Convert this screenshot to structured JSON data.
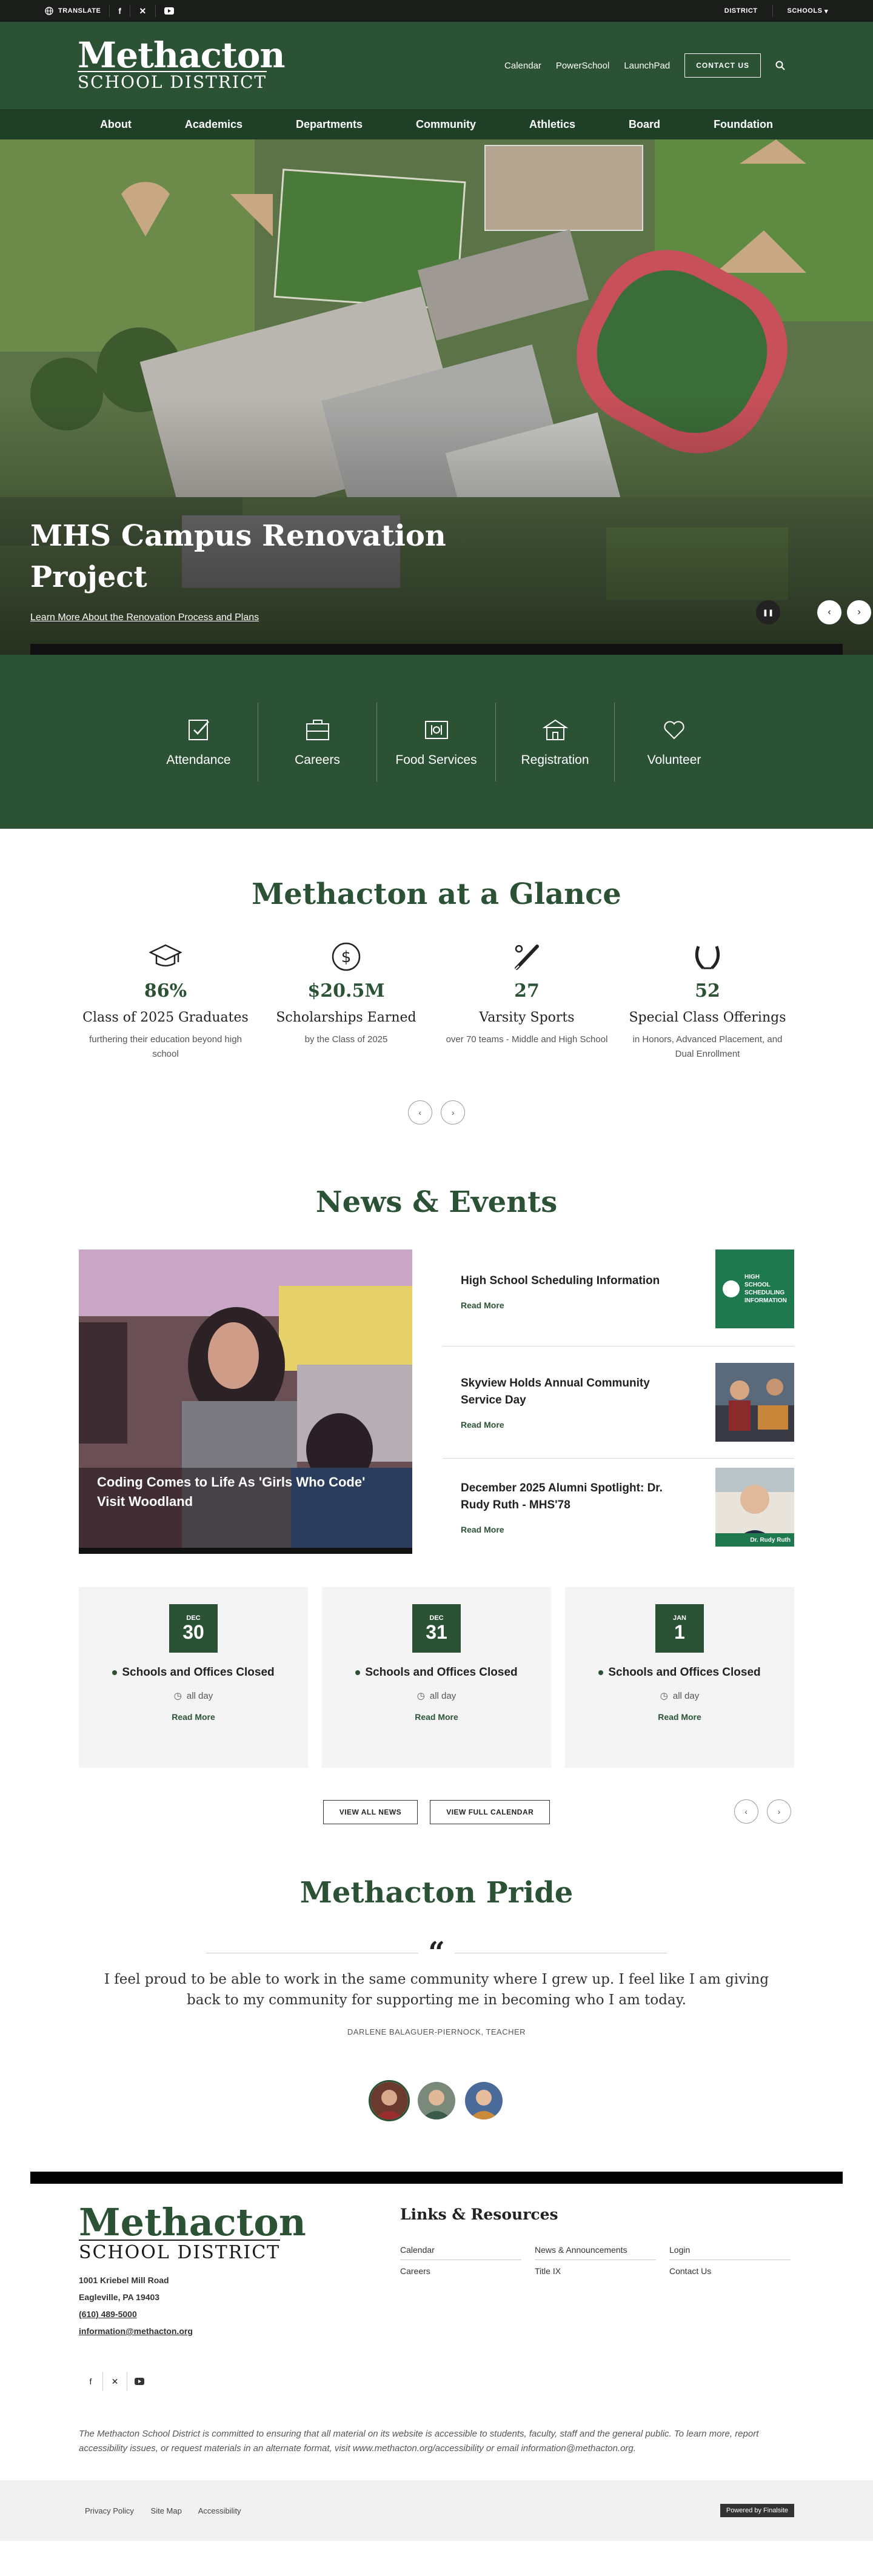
{
  "utility": {
    "translate": "TRANSLATE",
    "district": "DISTRICT",
    "schools": "SCHOOLS"
  },
  "brand": {
    "logo_top": "Methacton",
    "logo_bottom": "SCHOOL DISTRICT",
    "primary_color": "#2b5234",
    "dark_color": "#1f3f27"
  },
  "header": {
    "links": [
      "Calendar",
      "PowerSchool",
      "LaunchPad"
    ],
    "contact": "CONTACT US"
  },
  "nav": [
    "About",
    "Academics",
    "Departments",
    "Community",
    "Athletics",
    "Board",
    "Foundation"
  ],
  "hero": {
    "title": "MHS Campus Renovation Project",
    "link": "Learn More About the Renovation Process and Plans"
  },
  "quick_links": [
    {
      "label": "Attendance",
      "icon": "clipboard-check-icon"
    },
    {
      "label": "Careers",
      "icon": "briefcase-icon"
    },
    {
      "label": "Food Services",
      "icon": "menu-icon"
    },
    {
      "label": "Registration",
      "icon": "school-building-icon"
    },
    {
      "label": "Volunteer",
      "icon": "heart-hand-icon"
    }
  ],
  "glance": {
    "title": "Methacton at a Glance",
    "stats": [
      {
        "icon": "graduation-cap-icon",
        "value": "86%",
        "title": "Class of 2025 Graduates",
        "desc": "furthering their education beyond high school"
      },
      {
        "icon": "dollar-icon",
        "value": "$20.5M",
        "title": "Scholarships Earned",
        "desc": "by the Class of 2025"
      },
      {
        "icon": "baseball-bat-icon",
        "value": "27",
        "title": "Varsity Sports",
        "desc": "over 70 teams - Middle and High School"
      },
      {
        "icon": "laurel-wreath-icon",
        "value": "52",
        "title": "Special Class Offerings",
        "desc": "in Honors, Advanced Placement, and Dual Enrollment"
      }
    ]
  },
  "news": {
    "title": "News & Events",
    "feature": "Coding Comes to Life As 'Girls Who Code' Visit Woodland",
    "items": [
      {
        "title": "High School Scheduling Information",
        "read_more": "Read More",
        "thumb_text": "HIGH SCHOOL SCHEDULING INFORMATION"
      },
      {
        "title": "Skyview Holds Annual Community Service Day",
        "read_more": "Read More"
      },
      {
        "title": "December 2025 Alumni Spotlight: Dr. Rudy Ruth - MHS'78",
        "read_more": "Read More",
        "thumb_text": "Dr. Rudy Ruth"
      }
    ],
    "events": [
      {
        "month": "DEC",
        "day": "30",
        "title": "Schools and Offices Closed",
        "time": "all day",
        "read_more": "Read More"
      },
      {
        "month": "DEC",
        "day": "31",
        "title": "Schools and Offices Closed",
        "time": "all day",
        "read_more": "Read More"
      },
      {
        "month": "JAN",
        "day": "1",
        "title": "Schools and Offices Closed",
        "time": "all day",
        "read_more": "Read More"
      }
    ],
    "view_all": "VIEW ALL NEWS",
    "view_calendar": "VIEW FULL CALENDAR"
  },
  "pride": {
    "title": "Methacton Pride",
    "quote": "I feel proud to be able to work in the same community where I grew up. I feel like I am giving back to my community for supporting me in becoming who I am today.",
    "attribution": "DARLENE BALAGUER-PIERNOCK, TEACHER"
  },
  "footer": {
    "address1": "1001 Kriebel Mill Road",
    "address2": "Eagleville, PA  19403",
    "phone": "(610) 489-5000",
    "email": "information@methacton.org",
    "links_title": "Links & Resources",
    "links": [
      "Calendar",
      "News & Announcements",
      "Login",
      "Careers",
      "Title IX",
      "Contact Us"
    ],
    "disclaimer": "The Methacton School District is committed to ensuring that all material on its website is accessible to students, faculty, staff and the general public. To learn more, report accessibility issues, or request materials in an alternate format, visit www.methacton.org/accessibility or email information@methacton.org.",
    "bottom_links": [
      "Privacy Policy",
      "Site Map",
      "Accessibility"
    ],
    "powered": "Powered by Finalsite"
  }
}
